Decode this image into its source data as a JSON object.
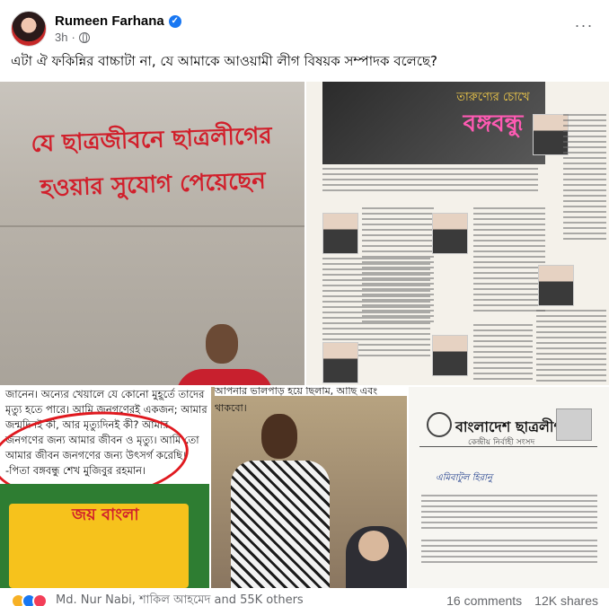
{
  "post": {
    "author": "Rumeen Farhana",
    "time": "3h",
    "separator": "·",
    "more": "···",
    "text": "এটা ঐ ফকিন্নির বাচ্চাটা না, যে আমাকে আওয়ামী লীগ বিষয়ক সম্পাদক বলেছে?"
  },
  "photos": {
    "p1": {
      "graffiti_line1": "যে ছাত্রজীবনে ছাত্রলীগের",
      "graffiti_line2": "হওয়ার সুযোগ পেয়েছেন"
    },
    "p2": {
      "banner_sub": "তারুণ্যের চোখে",
      "banner_title": "বঙ্গবন্ধু"
    },
    "p3": {
      "quote": "জানেন। অন্যের খেয়ালে যে কোনো মুহূর্তে তাদের মৃত্যু হতে পারে। আমি জনগণেরই একজন; আমার জন্মদিনই কী, আর মৃত্যুদিনই কী? আমার জনগণের জন্য আমার জীবন ও মৃত্যু। আমি তো আমার জীবন জনগণের জন্য উৎসর্গ করেছি।'",
      "attribution": "-পিতা বঙ্গবন্ধু শেখ মুজিবুর রহমান।",
      "mural_text": "জয় বাংলা"
    },
    "p4": {
      "caption": "আপনার ভালপাড় হয়ে ছিলাম, আছি এবং থাকবো।"
    },
    "p5": {
      "title": "বাংলাদেশ ছাত্রলীগ",
      "subtitle": "কেন্দ্রীয় নির্বাহী সংসদ",
      "addressee": "এমিবাটুল হিরানু"
    }
  },
  "footer": {
    "reactors": "Md. Nur Nabi, শাকিল আহমেদ and 55K others",
    "comments": "16 comments",
    "shares": "12K shares"
  },
  "colors": {
    "accent": "#1877f2",
    "graffiti": "#d11f2b",
    "banner_title": "#ff5ab3"
  }
}
